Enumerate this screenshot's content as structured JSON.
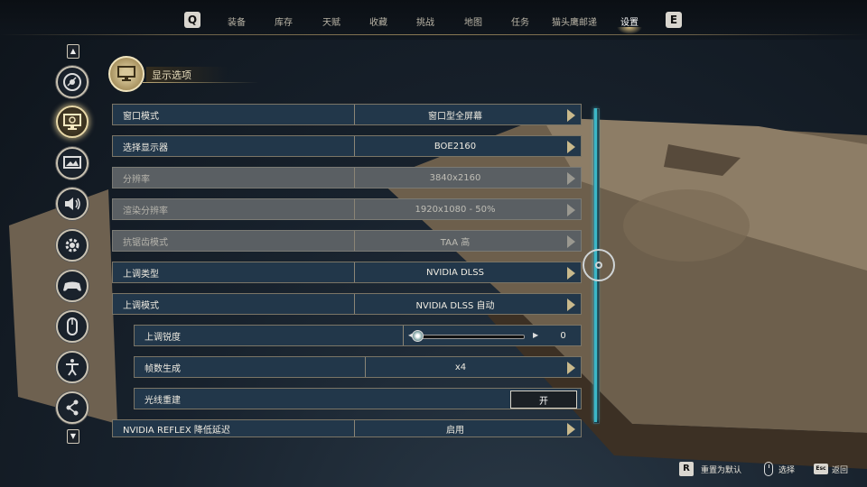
{
  "nav": {
    "left_key": "Q",
    "right_key": "E",
    "tabs": [
      {
        "label": "装备"
      },
      {
        "label": "库存"
      },
      {
        "label": "天赋"
      },
      {
        "label": "收藏"
      },
      {
        "label": "挑战"
      },
      {
        "label": "地图"
      },
      {
        "label": "任务"
      },
      {
        "label": "猫头鹰邮递"
      },
      {
        "label": "设置",
        "active": true
      }
    ]
  },
  "sidebar": {
    "items": [
      {
        "icon": "disc-icon"
      },
      {
        "icon": "display-icon",
        "active": true
      },
      {
        "icon": "graphics-icon"
      },
      {
        "icon": "audio-icon"
      },
      {
        "icon": "gameplay-gear-icon"
      },
      {
        "icon": "controller-icon"
      },
      {
        "icon": "mouse-icon"
      },
      {
        "icon": "accessibility-icon"
      },
      {
        "icon": "social-icon"
      }
    ]
  },
  "section": {
    "title": "显示选项",
    "icon": "monitor-icon"
  },
  "settings": [
    {
      "label": "窗口模式",
      "value": "窗口型全屏幕",
      "enabled": true,
      "kind": "select"
    },
    {
      "label": "选择显示器",
      "value": "BOE2160",
      "enabled": true,
      "kind": "select"
    },
    {
      "label": "分辨率",
      "value": "3840x2160",
      "enabled": false,
      "kind": "select"
    },
    {
      "label": "渲染分辨率",
      "value": "1920x1080 - 50%",
      "enabled": false,
      "kind": "select"
    },
    {
      "label": "抗锯齿模式",
      "value": "TAA 高",
      "enabled": false,
      "kind": "select"
    },
    {
      "label": "上调类型",
      "value": "NVIDIA DLSS",
      "enabled": true,
      "kind": "select"
    },
    {
      "label": "上调模式",
      "value": "NVIDIA DLSS 自动",
      "enabled": true,
      "kind": "select"
    },
    {
      "label": "上调锐度",
      "value": "0",
      "enabled": true,
      "kind": "slider",
      "level": 0
    },
    {
      "label": "帧数生成",
      "value": "x4",
      "enabled": true,
      "kind": "select"
    },
    {
      "label": "光线重建",
      "value": "开",
      "enabled": true,
      "kind": "toggle"
    },
    {
      "label": "NVIDIA REFLEX 降低延迟",
      "value": "启用",
      "enabled": true,
      "kind": "select"
    }
  ],
  "scroll": {
    "position": 0.5
  },
  "footer": {
    "reset_key": "R",
    "reset_label": "重置为默认",
    "select_label": "选择",
    "back_key": "Esc",
    "back_label": "返回"
  },
  "colors": {
    "row_bg": "#22374a",
    "row_disabled_bg": "#5a5f63",
    "scroll_accent": "#3cb7c7",
    "gold_accent": "#c9b98c"
  }
}
